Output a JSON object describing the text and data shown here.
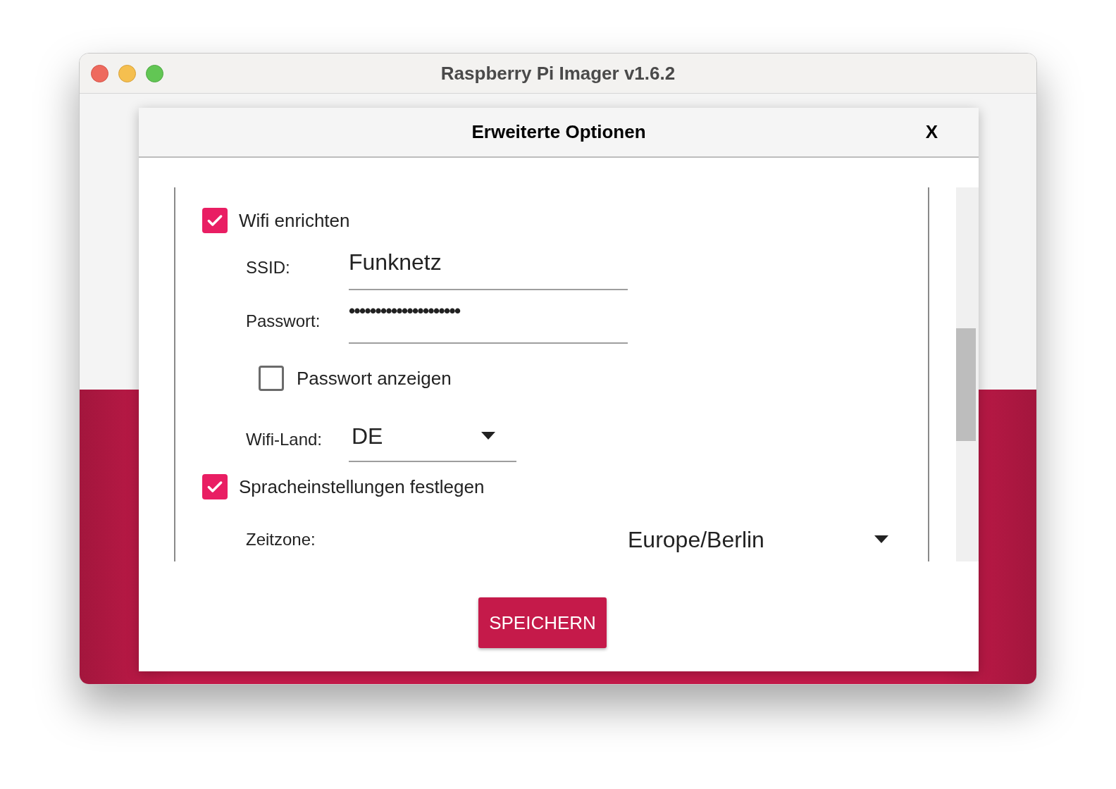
{
  "window": {
    "title": "Raspberry Pi Imager v1.6.2"
  },
  "dialog": {
    "title": "Erweiterte Optionen",
    "close": "X"
  },
  "options": [
    {
      "kind": "checkbox",
      "label": "Wifi enrichten",
      "checked": true
    },
    {
      "kind": "field",
      "label": "SSID:",
      "value": "Funknetz"
    },
    {
      "kind": "password",
      "label": "Passwort:",
      "value": "•••••••••••••••••••••"
    },
    {
      "kind": "subcheckbox",
      "label": "Passwort anzeigen",
      "checked": false
    },
    {
      "kind": "dropdown",
      "label": "Wifi-Land:",
      "value": "DE"
    },
    {
      "kind": "checkbox",
      "label": "Spracheinstellungen festlegen",
      "checked": true
    },
    {
      "kind": "wide-dropdown",
      "label": "Zeitzone:",
      "value": "Europe/Berlin"
    }
  ],
  "save_button": "SPEICHERN"
}
